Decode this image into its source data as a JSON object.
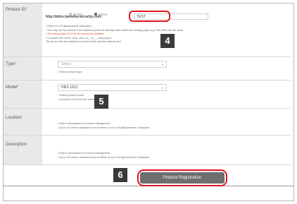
{
  "form": {
    "product_id": {
      "label": "Product ID",
      "required_mark": "*",
      "radio_options": [
        "IPAddr",
        "DDNS"
      ],
      "selected_radio": "DDNS",
      "url_prefix": "http://ddns.hanwha-security.com/",
      "value": "TEST",
      "notes": [
        "• Enter 4 to 20 alphanumeric characters.",
        "• You may use the window if the entered product ID already exists within the settings page (e.g. SNC-590) are the same.",
        "• The final product ID to be set cannot be modified.",
        "• Unusable IDs: some, drop, xxxx, xx__xx__, xxx(xxx)xxx,",
        "   The above IDs are restricted to prevent SQL injection attacks and."
      ],
      "red_note_index": 2
    },
    "type": {
      "label": "Type",
      "required_mark": "*",
      "value": "Select",
      "notes": [
        "• Select product type."
      ]
    },
    "model": {
      "label": "Model",
      "required_mark": "*",
      "value": "HRX-1621",
      "notes": [
        "• Select product model.",
        "• If model is not in the list, select (ETC)."
      ]
    },
    "location": {
      "label": "Location",
      "notes": [
        "• Enter a description for product management.",
        "• Up to 15 Korean characters and numbers or up to 30 alphanumeric characters."
      ]
    },
    "description": {
      "label": "Description",
      "notes": [
        "• Enter a description for product management.",
        "• Up to 15 Korean characters and numbers or up to 30 alphanumeric characters."
      ]
    }
  },
  "steps": [
    "4",
    "5",
    "6"
  ],
  "submit_label": "Product Registration",
  "colors": {
    "highlight": "#e0161e",
    "badge": "#3a3a3a",
    "button": "#6e6e6e",
    "label_bg": "#e9e9ea"
  }
}
